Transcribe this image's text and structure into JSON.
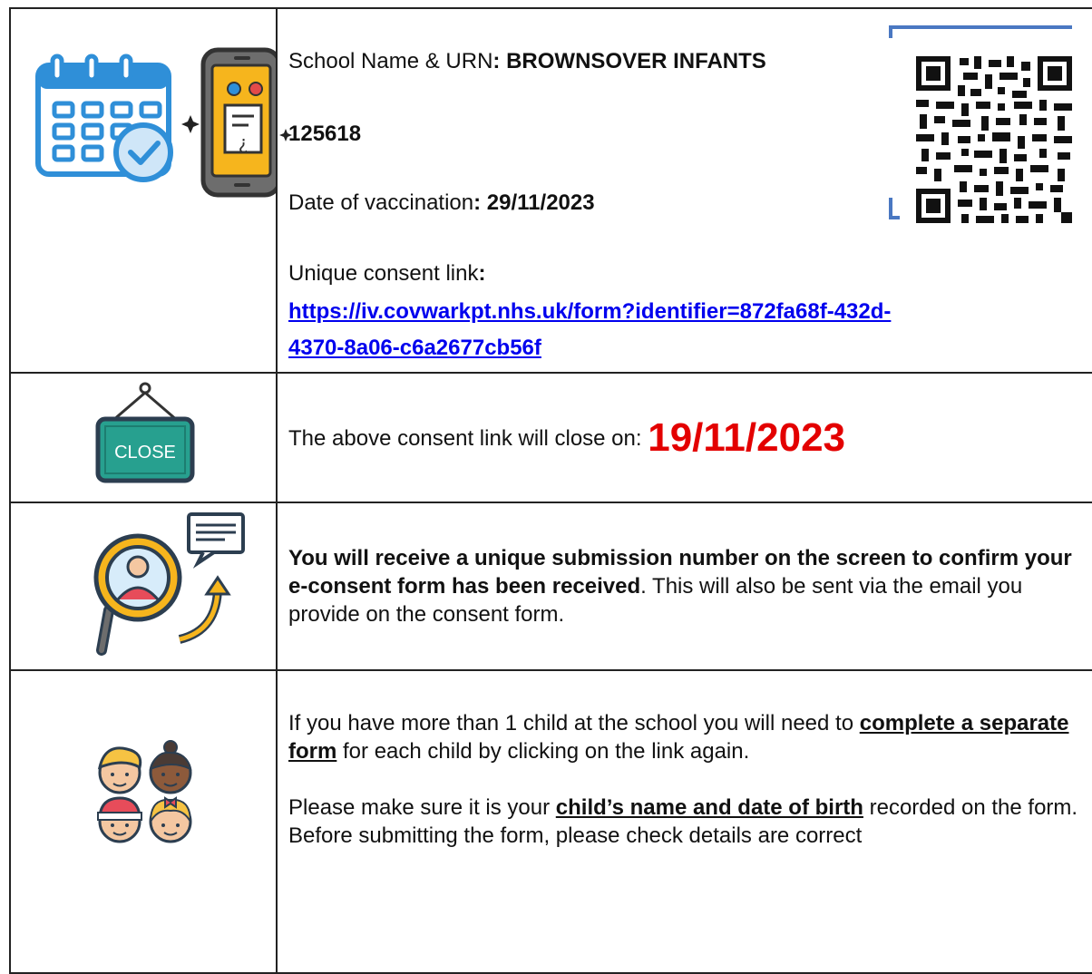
{
  "school": {
    "label": "School Name & URN",
    "sep": ": ",
    "name": "BROWNSOVER INFANTS",
    "urn": "125618"
  },
  "vaccination": {
    "label": "Date of vaccination",
    "sep": ": ",
    "date": "29/11/2023"
  },
  "consent_link": {
    "label": "Unique consent link",
    "sep": ":",
    "url_line1": "https://iv.covwarkpt.nhs.uk/form?identifier=872fa68f-432d-",
    "url_line2": "4370-8a06-c6a2677cb56f"
  },
  "close": {
    "sign_text": "CLOSE",
    "text": "The above consent link will close on: ",
    "date": "19/11/2023"
  },
  "submission": {
    "bold_text": "You will receive a unique submission number on the screen to confirm your e-consent form has been received",
    "rest_text": ". This will also be sent via the email you provide on the consent form."
  },
  "children": {
    "p1_a": "If you have more than 1 child at the school you will need to ",
    "p1_u": "complete a separate form",
    "p1_b": " for each child by clicking on the link again.",
    "p2_a": "Please make sure it is your ",
    "p2_u": "child’s name and date of birth",
    "p2_b": " recorded on the form. Before submitting the form, please check details are correct"
  },
  "colors": {
    "link": "#0000ee",
    "close_date": "#e30000",
    "calendar": "#2f8fd8",
    "phone": "#f6b51d",
    "sign": "#27a08f"
  },
  "icons": [
    "calendar-check-icon",
    "smartphone-form-icon",
    "qr-code-icon",
    "close-sign-icon",
    "search-user-icon",
    "children-icon"
  ]
}
